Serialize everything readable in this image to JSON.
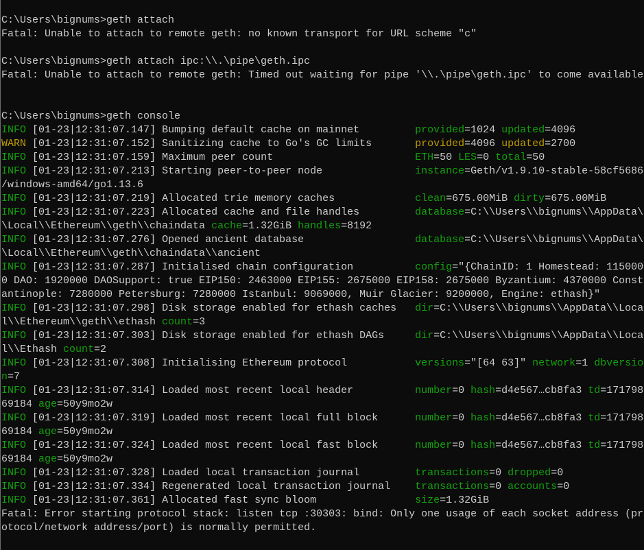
{
  "colors": {
    "background": "#0c0c0c",
    "text": "#cccccc",
    "info": "#13a10e",
    "warn": "#c19c00"
  },
  "lines": [
    {
      "segs": []
    },
    {
      "segs": [
        {
          "t": "C:\\Users\\bignums>geth attach",
          "c": "w"
        }
      ]
    },
    {
      "segs": [
        {
          "t": "Fatal: Unable to attach to remote geth: no known transport for URL scheme \"c\"",
          "c": "w"
        }
      ]
    },
    {
      "segs": []
    },
    {
      "segs": [
        {
          "t": "C:\\Users\\bignums>geth attach ipc:\\\\.\\pipe\\geth.ipc",
          "c": "w"
        }
      ]
    },
    {
      "segs": [
        {
          "t": "Fatal: Unable to attach to remote geth: Timed out waiting for pipe '\\\\.\\pipe\\geth.ipc' to come available",
          "c": "w"
        }
      ]
    },
    {
      "segs": []
    },
    {
      "segs": []
    },
    {
      "segs": [
        {
          "t": "C:\\Users\\bignums>geth console",
          "c": "w"
        }
      ]
    },
    {
      "level": "INFO",
      "c": "g",
      "time": "01-23|12:31:07.147",
      "msg": "Bumping default cache on mainnet",
      "segs": [
        {
          "t": "provided",
          "c": "g"
        },
        {
          "t": "=1024 ",
          "c": "w"
        },
        {
          "t": "updated",
          "c": "g"
        },
        {
          "t": "=4096",
          "c": "w"
        }
      ]
    },
    {
      "level": "WARN",
      "c": "y",
      "time": "01-23|12:31:07.152",
      "msg": "Sanitizing cache to Go's GC limits",
      "segs": [
        {
          "t": "provided",
          "c": "y"
        },
        {
          "t": "=4096 ",
          "c": "w"
        },
        {
          "t": "updated",
          "c": "y"
        },
        {
          "t": "=2700",
          "c": "w"
        }
      ]
    },
    {
      "level": "INFO",
      "c": "g",
      "time": "01-23|12:31:07.159",
      "msg": "Maximum peer count",
      "segs": [
        {
          "t": "ETH",
          "c": "g"
        },
        {
          "t": "=50 ",
          "c": "w"
        },
        {
          "t": "LES",
          "c": "g"
        },
        {
          "t": "=0 ",
          "c": "w"
        },
        {
          "t": "total",
          "c": "g"
        },
        {
          "t": "=50",
          "c": "w"
        }
      ]
    },
    {
      "level": "INFO",
      "c": "g",
      "time": "01-23|12:31:07.213",
      "msg": "Starting peer-to-peer node",
      "segs": [
        {
          "t": "instance",
          "c": "g"
        },
        {
          "t": "=Geth/v1.9.10-stable-58cf5686",
          "c": "w"
        }
      ]
    },
    {
      "segs": [
        {
          "t": "/windows-amd64/go1.13.6",
          "c": "w"
        }
      ]
    },
    {
      "level": "INFO",
      "c": "g",
      "time": "01-23|12:31:07.219",
      "msg": "Allocated trie memory caches",
      "segs": [
        {
          "t": "clean",
          "c": "g"
        },
        {
          "t": "=675.00MiB ",
          "c": "w"
        },
        {
          "t": "dirty",
          "c": "g"
        },
        {
          "t": "=675.00MiB",
          "c": "w"
        }
      ]
    },
    {
      "level": "INFO",
      "c": "g",
      "time": "01-23|12:31:07.223",
      "msg": "Allocated cache and file handles",
      "segs": [
        {
          "t": "database",
          "c": "g"
        },
        {
          "t": "=C:\\\\Users\\\\bignums\\\\AppData\\",
          "c": "w"
        }
      ]
    },
    {
      "segs": [
        {
          "t": "\\Local\\\\Ethereum\\\\geth\\\\chaindata ",
          "c": "w"
        },
        {
          "t": "cache",
          "c": "g"
        },
        {
          "t": "=1.32GiB ",
          "c": "w"
        },
        {
          "t": "handles",
          "c": "g"
        },
        {
          "t": "=8192",
          "c": "w"
        }
      ]
    },
    {
      "level": "INFO",
      "c": "g",
      "time": "01-23|12:31:07.276",
      "msg": "Opened ancient database",
      "segs": [
        {
          "t": "database",
          "c": "g"
        },
        {
          "t": "=C:\\\\Users\\\\bignums\\\\AppData\\",
          "c": "w"
        }
      ]
    },
    {
      "segs": [
        {
          "t": "\\Local\\\\Ethereum\\\\geth\\\\chaindata\\\\ancient",
          "c": "w"
        }
      ]
    },
    {
      "level": "INFO",
      "c": "g",
      "time": "01-23|12:31:07.287",
      "msg": "Initialised chain configuration",
      "segs": [
        {
          "t": "config",
          "c": "g"
        },
        {
          "t": "=\"{ChainID: 1 Homestead: 115000",
          "c": "w"
        }
      ]
    },
    {
      "segs": [
        {
          "t": "0 DAO: 1920000 DAOSupport: true EIP150: 2463000 EIP155: 2675000 EIP158: 2675000 Byzantium: 4370000 Const",
          "c": "w"
        }
      ]
    },
    {
      "segs": [
        {
          "t": "antinople: 7280000 Petersburg: 7280000 Istanbul: 9069000, Muir Glacier: 9200000, Engine: ethash}\"",
          "c": "w"
        }
      ]
    },
    {
      "level": "INFO",
      "c": "g",
      "time": "01-23|12:31:07.298",
      "msg": "Disk storage enabled for ethash caches",
      "segs": [
        {
          "t": "dir",
          "c": "g"
        },
        {
          "t": "=C:\\\\Users\\\\bignums\\\\AppData\\\\Loca",
          "c": "w"
        }
      ]
    },
    {
      "segs": [
        {
          "t": "l\\\\Ethereum\\\\geth\\\\ethash ",
          "c": "w"
        },
        {
          "t": "count",
          "c": "g"
        },
        {
          "t": "=3",
          "c": "w"
        }
      ]
    },
    {
      "level": "INFO",
      "c": "g",
      "time": "01-23|12:31:07.303",
      "msg": "Disk storage enabled for ethash DAGs",
      "segs": [
        {
          "t": "dir",
          "c": "g"
        },
        {
          "t": "=C:\\\\Users\\\\bignums\\\\AppData\\\\Loca",
          "c": "w"
        }
      ]
    },
    {
      "segs": [
        {
          "t": "l\\\\Ethash ",
          "c": "w"
        },
        {
          "t": "count",
          "c": "g"
        },
        {
          "t": "=2",
          "c": "w"
        }
      ]
    },
    {
      "level": "INFO",
      "c": "g",
      "time": "01-23|12:31:07.308",
      "msg": "Initialising Ethereum protocol",
      "segs": [
        {
          "t": "versions",
          "c": "g"
        },
        {
          "t": "=\"[64 63]\" ",
          "c": "w"
        },
        {
          "t": "network",
          "c": "g"
        },
        {
          "t": "=1 ",
          "c": "w"
        },
        {
          "t": "dbversio",
          "c": "g"
        }
      ]
    },
    {
      "segs": [
        {
          "t": "n",
          "c": "g"
        },
        {
          "t": "=7",
          "c": "w"
        }
      ]
    },
    {
      "level": "INFO",
      "c": "g",
      "time": "01-23|12:31:07.314",
      "msg": "Loaded most recent local header",
      "segs": [
        {
          "t": "number",
          "c": "g"
        },
        {
          "t": "=0 ",
          "c": "w"
        },
        {
          "t": "hash",
          "c": "g"
        },
        {
          "t": "=d4e567…cb8fa3 ",
          "c": "w"
        },
        {
          "t": "td",
          "c": "g"
        },
        {
          "t": "=171798",
          "c": "w"
        }
      ]
    },
    {
      "segs": [
        {
          "t": "69184 ",
          "c": "w"
        },
        {
          "t": "age",
          "c": "g"
        },
        {
          "t": "=50y9mo2w",
          "c": "w"
        }
      ]
    },
    {
      "level": "INFO",
      "c": "g",
      "time": "01-23|12:31:07.319",
      "msg": "Loaded most recent local full block",
      "segs": [
        {
          "t": "number",
          "c": "g"
        },
        {
          "t": "=0 ",
          "c": "w"
        },
        {
          "t": "hash",
          "c": "g"
        },
        {
          "t": "=d4e567…cb8fa3 ",
          "c": "w"
        },
        {
          "t": "td",
          "c": "g"
        },
        {
          "t": "=171798",
          "c": "w"
        }
      ]
    },
    {
      "segs": [
        {
          "t": "69184 ",
          "c": "w"
        },
        {
          "t": "age",
          "c": "g"
        },
        {
          "t": "=50y9mo2w",
          "c": "w"
        }
      ]
    },
    {
      "level": "INFO",
      "c": "g",
      "time": "01-23|12:31:07.324",
      "msg": "Loaded most recent local fast block",
      "segs": [
        {
          "t": "number",
          "c": "g"
        },
        {
          "t": "=0 ",
          "c": "w"
        },
        {
          "t": "hash",
          "c": "g"
        },
        {
          "t": "=d4e567…cb8fa3 ",
          "c": "w"
        },
        {
          "t": "td",
          "c": "g"
        },
        {
          "t": "=171798",
          "c": "w"
        }
      ]
    },
    {
      "segs": [
        {
          "t": "69184 ",
          "c": "w"
        },
        {
          "t": "age",
          "c": "g"
        },
        {
          "t": "=50y9mo2w",
          "c": "w"
        }
      ]
    },
    {
      "level": "INFO",
      "c": "g",
      "time": "01-23|12:31:07.328",
      "msg": "Loaded local transaction journal",
      "segs": [
        {
          "t": "transactions",
          "c": "g"
        },
        {
          "t": "=0 ",
          "c": "w"
        },
        {
          "t": "dropped",
          "c": "g"
        },
        {
          "t": "=0",
          "c": "w"
        }
      ]
    },
    {
      "level": "INFO",
      "c": "g",
      "time": "01-23|12:31:07.334",
      "msg": "Regenerated local transaction journal",
      "segs": [
        {
          "t": "transactions",
          "c": "g"
        },
        {
          "t": "=0 ",
          "c": "w"
        },
        {
          "t": "accounts",
          "c": "g"
        },
        {
          "t": "=0",
          "c": "w"
        }
      ]
    },
    {
      "level": "INFO",
      "c": "g",
      "time": "01-23|12:31:07.361",
      "msg": "Allocated fast sync bloom",
      "segs": [
        {
          "t": "size",
          "c": "g"
        },
        {
          "t": "=1.32GiB",
          "c": "w"
        }
      ]
    },
    {
      "segs": [
        {
          "t": "Fatal: Error starting protocol stack: listen tcp :30303: bind: Only one usage of each socket address (pr",
          "c": "w"
        }
      ]
    },
    {
      "segs": [
        {
          "t": "otocol/network address/port) is normally permitted.",
          "c": "w"
        }
      ]
    }
  ]
}
